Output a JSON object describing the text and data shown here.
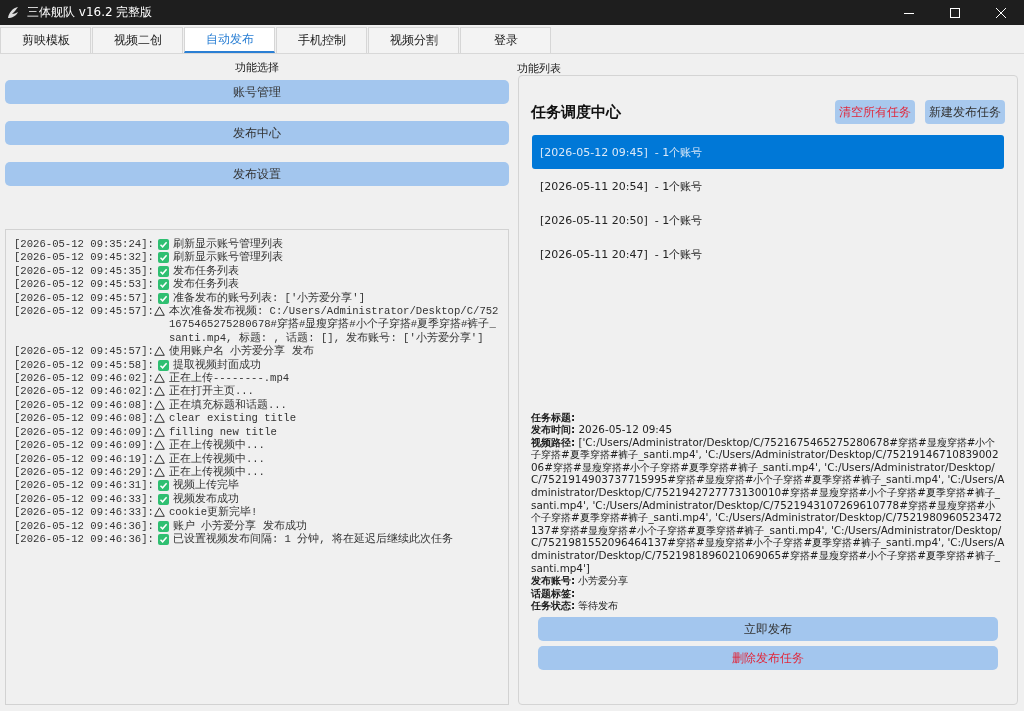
{
  "window": {
    "title": "三体舰队 v16.2 完整版"
  },
  "tabs": [
    {
      "label": "剪映模板",
      "selected": false
    },
    {
      "label": "视频二创",
      "selected": false
    },
    {
      "label": "自动发布",
      "selected": true
    },
    {
      "label": "手机控制",
      "selected": false
    },
    {
      "label": "视频分割",
      "selected": false
    },
    {
      "label": "登录",
      "selected": false
    }
  ],
  "function_select": {
    "title": "功能选择",
    "buttons": [
      "账号管理",
      "发布中心",
      "发布设置"
    ]
  },
  "log": [
    {
      "time": "[2026-05-12 09:35:24]:",
      "kind": "ok",
      "message": "刷新显示账号管理列表"
    },
    {
      "time": "[2026-05-12 09:45:32]:",
      "kind": "ok",
      "message": "刷新显示账号管理列表"
    },
    {
      "time": "[2026-05-12 09:45:35]:",
      "kind": "ok",
      "message": "发布任务列表"
    },
    {
      "time": "[2026-05-12 09:45:53]:",
      "kind": "ok",
      "message": "发布任务列表"
    },
    {
      "time": "[2026-05-12 09:45:57]:",
      "kind": "ok",
      "message": "准备发布的账号列表: ['小芳爱分享']"
    },
    {
      "time": "[2026-05-12 09:45:57]:",
      "kind": "warn",
      "message": "本次准备发布视频: C:/Users/Administrator/Desktop/C/7521675465275280678#穿搭#显瘦穿搭#小个子穿搭#夏季穿搭#裤子_santi.mp4, 标题: , 话题: [], 发布账号: ['小芳爱分享']"
    },
    {
      "time": "[2026-05-12 09:45:57]:",
      "kind": "warn",
      "message": "使用账户名 小芳爱分享 发布"
    },
    {
      "time": "[2026-05-12 09:45:58]:",
      "kind": "ok",
      "message": "提取视频封面成功"
    },
    {
      "time": "[2026-05-12 09:46:02]:",
      "kind": "warn",
      "message": "正在上传--------.mp4"
    },
    {
      "time": "[2026-05-12 09:46:02]:",
      "kind": "warn",
      "message": "正在打开主页..."
    },
    {
      "time": "[2026-05-12 09:46:08]:",
      "kind": "warn",
      "message": "正在填充标题和话题..."
    },
    {
      "time": "[2026-05-12 09:46:08]:",
      "kind": "warn",
      "message": "clear existing title"
    },
    {
      "time": "[2026-05-12 09:46:09]:",
      "kind": "warn",
      "message": "filling new  title"
    },
    {
      "time": "[2026-05-12 09:46:09]:",
      "kind": "warn",
      "message": "正在上传视频中..."
    },
    {
      "time": "[2026-05-12 09:46:19]:",
      "kind": "warn",
      "message": "正在上传视频中..."
    },
    {
      "time": "[2026-05-12 09:46:29]:",
      "kind": "warn",
      "message": "正在上传视频中..."
    },
    {
      "time": "[2026-05-12 09:46:31]:",
      "kind": "ok",
      "message": "视频上传完毕"
    },
    {
      "time": "[2026-05-12 09:46:33]:",
      "kind": "ok",
      "message": "视频发布成功"
    },
    {
      "time": "[2026-05-12 09:46:33]:",
      "kind": "warn",
      "message": "cookie更新完毕!"
    },
    {
      "time": "[2026-05-12 09:46:36]:",
      "kind": "ok",
      "message": "账户 小芳爱分享 发布成功"
    },
    {
      "time": "[2026-05-12 09:46:36]:",
      "kind": "ok",
      "message": "已设置视频发布间隔: 1 分钟, 将在延迟后继续此次任务"
    }
  ],
  "function_list": {
    "title": "功能列表",
    "heading": "任务调度中心",
    "clear_button": "清空所有任务",
    "new_button": "新建发布任务",
    "tasks": [
      {
        "label": "[2026-05-12 09:45]  - 1个账号",
        "selected": true
      },
      {
        "label": "[2026-05-11 20:54]  - 1个账号",
        "selected": false
      },
      {
        "label": "[2026-05-11 20:50]  - 1个账号",
        "selected": false
      },
      {
        "label": "[2026-05-11 20:47]  - 1个账号",
        "selected": false
      }
    ],
    "details": [
      "**任务标题:**",
      "**发布时间:** 2026-05-12 09:45",
      "**视频路径:** ['C:/Users/Administrator/Desktop/C/7521675465275280678#穿搭#显瘦穿搭#小个子穿搭#夏季穿搭#裤子_santi.mp4', 'C:/Users/Administrator/Desktop/C/7521914671083900206#穿搭#显瘦穿搭#小个子穿搭#夏季穿搭#裤子_santi.mp4', 'C:/Users/Administrator/Desktop/C/7521914903737715995#穿搭#显瘦穿搭#小个子穿搭#夏季穿搭#裤子_santi.mp4', 'C:/Users/Administrator/Desktop/C/7521942727773130010#穿搭#显瘦穿搭#小个子穿搭#夏季穿搭#裤子_santi.mp4', 'C:/Users/Administrator/Desktop/C/7521943107269610778#穿搭#显瘦穿搭#小个子穿搭#夏季穿搭#裤子_santi.mp4', 'C:/Users/Administrator/Desktop/C/7521980960523472137#穿搭#显瘦穿搭#小个子穿搭#夏季穿搭#裤子_santi.mp4', 'C:/Users/Administrator/Desktop/C/7521981552096464137#穿搭#显瘦穿搭#小个子穿搭#夏季穿搭#裤子_santi.mp4', 'C:/Users/Administrator/Desktop/C/7521981896021069065#穿搭#显瘦穿搭#小个子穿搭#夏季穿搭#裤子_santi.mp4']",
      "**发布账号:** 小芳爱分享",
      "**话题标签:**",
      "**任务状态:** 等待发布"
    ],
    "publish_button": "立即发布",
    "delete_button": "删除发布任务"
  }
}
